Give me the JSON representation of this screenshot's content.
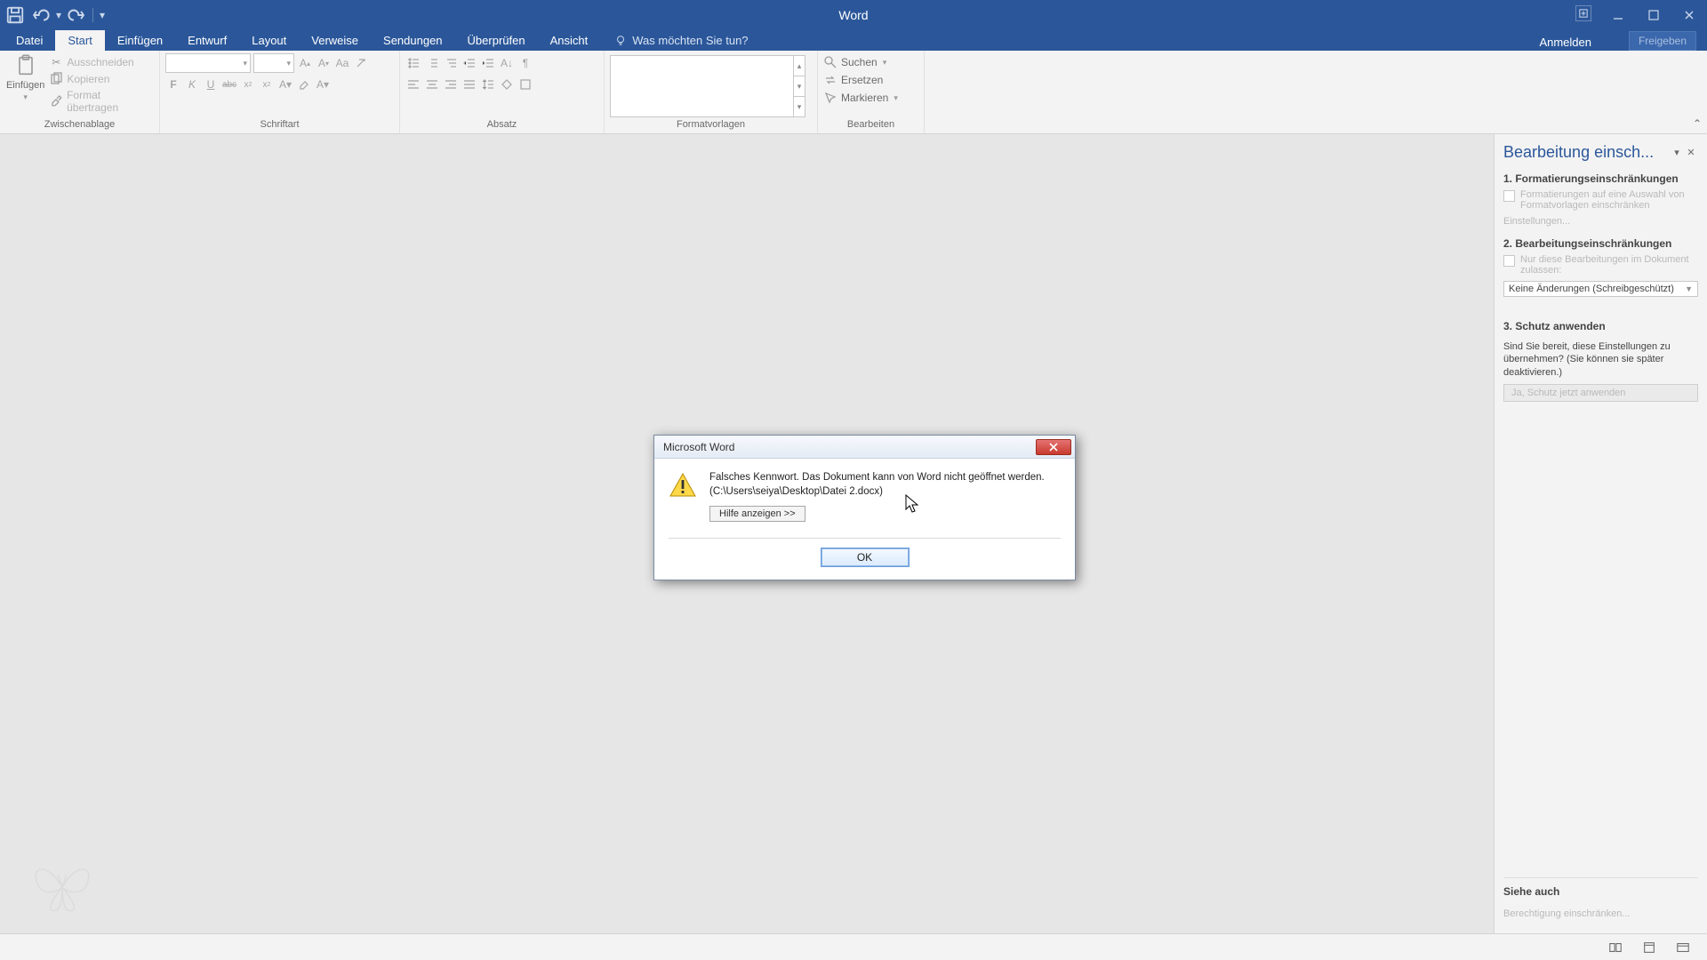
{
  "app": {
    "title": "Word"
  },
  "qat": {
    "save": "save-icon",
    "undo": "undo-icon",
    "redo": "redo-icon"
  },
  "tabs": {
    "file": "Datei",
    "items": [
      "Start",
      "Einfügen",
      "Entwurf",
      "Layout",
      "Verweise",
      "Sendungen",
      "Überprüfen",
      "Ansicht"
    ],
    "active_index": 0
  },
  "tellme": {
    "placeholder": "Was möchten Sie tun?"
  },
  "account": {
    "signin": "Anmelden",
    "share": "Freigeben"
  },
  "ribbon": {
    "clipboard": {
      "label": "Zwischenablage",
      "paste": "Einfügen",
      "cut": "Ausschneiden",
      "copy": "Kopieren",
      "format_painter": "Format übertragen"
    },
    "font": {
      "label": "Schriftart",
      "b": "F",
      "i": "K",
      "u": "U",
      "strike": "abc",
      "sub": "x",
      "sup": "x",
      "aclear": "Aa"
    },
    "paragraph": {
      "label": "Absatz"
    },
    "styles": {
      "label": "Formatvorlagen"
    },
    "editing": {
      "label": "Bearbeiten",
      "find": "Suchen",
      "replace": "Ersetzen",
      "select": "Markieren"
    }
  },
  "sidepane": {
    "title": "Bearbeitung einsch...",
    "s1": {
      "heading": "1. Formatierungseinschränkungen",
      "check": "Formatierungen auf eine Auswahl von Formatvorlagen einschränken",
      "settings": "Einstellungen..."
    },
    "s2": {
      "heading": "2. Bearbeitungseinschränkungen",
      "check": "Nur diese Bearbeitungen im Dokument zulassen:",
      "combo": "Keine Änderungen (Schreibgeschützt)"
    },
    "s3": {
      "heading": "3. Schutz anwenden",
      "para": "Sind Sie bereit, diese Einstellungen zu übernehmen? (Sie können sie später deaktivieren.)",
      "btn": "Ja, Schutz jetzt anwenden"
    },
    "footer": {
      "heading": "Siehe auch",
      "link": "Berechtigung einschränken..."
    }
  },
  "dialog": {
    "title": "Microsoft Word",
    "msg1": "Falsches Kennwort. Das Dokument kann von Word nicht geöffnet werden.",
    "msg2": "(C:\\Users\\seiya\\Desktop\\Datei 2.docx)",
    "help": "Hilfe anzeigen >>",
    "ok": "OK"
  }
}
